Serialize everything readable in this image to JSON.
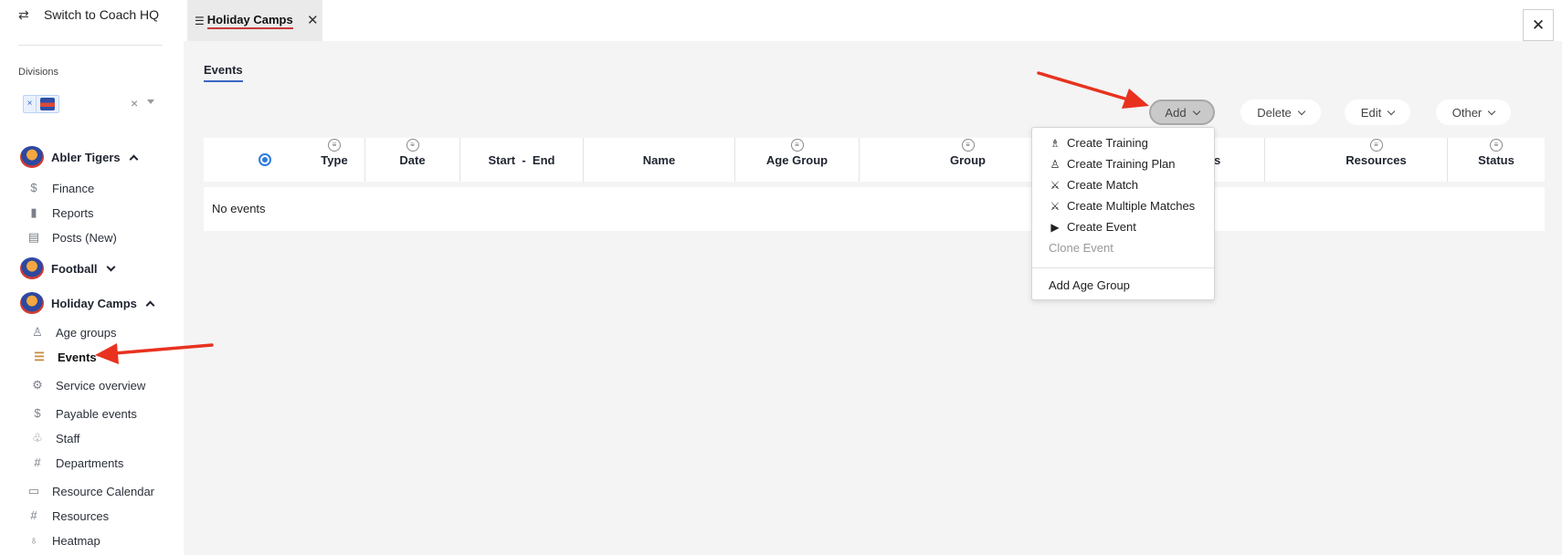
{
  "sidebar": {
    "switch_label": "Switch to Coach HQ",
    "divisions_label": "Divisions",
    "division_chip_remove": "×",
    "clear_label": "×",
    "clubs": [
      {
        "name": "Abler Tigers"
      },
      {
        "name": "Football"
      },
      {
        "name": "Holiday Camps"
      }
    ],
    "abler_items": [
      {
        "label": "Finance",
        "icon": "$"
      },
      {
        "label": "Reports",
        "icon": "▮"
      },
      {
        "label": "Posts (New)",
        "icon": "▤"
      }
    ],
    "holiday_items": [
      {
        "label": "Age groups",
        "icon": "♙"
      },
      {
        "label": "Events",
        "icon": "☰"
      },
      {
        "label": "Service overview",
        "icon": "⚙"
      },
      {
        "label": "Payable events",
        "icon": "$"
      },
      {
        "label": "Staff",
        "icon": "♧"
      },
      {
        "label": "Departments",
        "icon": "#"
      }
    ],
    "bottom_items": [
      {
        "label": "Resource Calendar",
        "icon": "▭"
      },
      {
        "label": "Resources",
        "icon": "#"
      },
      {
        "label": "Heatmap",
        "icon": "♁"
      }
    ]
  },
  "tabs": {
    "active_tab": "Holiday Camps",
    "tab_icon": "☰",
    "tab_close": "✕",
    "window_close": "✕"
  },
  "main": {
    "subtab": "Events",
    "actions": [
      "Add",
      "Delete",
      "Edit",
      "Other"
    ],
    "columns": [
      "Type",
      "Date",
      "Start  -  End",
      "Name",
      "Age Group",
      "Group",
      "s",
      "Resources",
      "Status"
    ],
    "empty_message": "No events"
  },
  "add_menu": {
    "items": [
      {
        "label": "Create Training",
        "icon": "♗"
      },
      {
        "label": "Create Training Plan",
        "icon": "♙"
      },
      {
        "label": "Create Match",
        "icon": "⚔"
      },
      {
        "label": "Create Multiple Matches",
        "icon": "⚔"
      },
      {
        "label": "Create Event",
        "icon": "▶"
      },
      {
        "label": "Clone Event",
        "icon": ""
      }
    ],
    "footer_item": "Add Age Group"
  },
  "colors": {
    "accent_blue": "#3a68c4",
    "tab_underline": "#c93a3a",
    "annotation_arrow": "#e8321f"
  }
}
